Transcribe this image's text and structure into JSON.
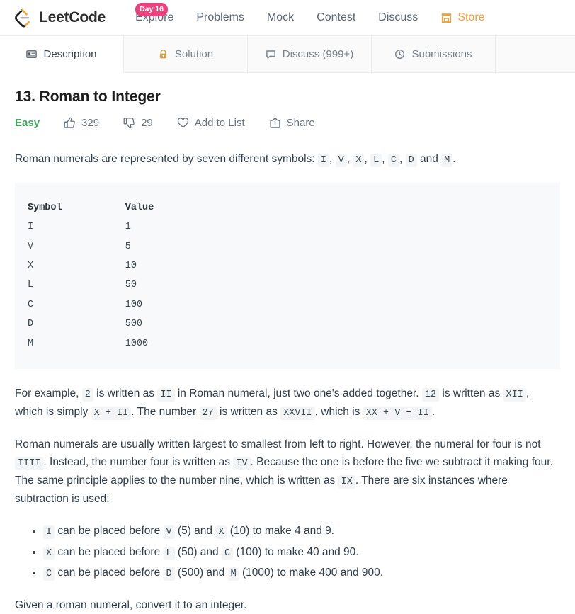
{
  "nav": {
    "brand_name": "LeetCode",
    "brand_logo_icon": "leetcode-logo-icon",
    "day_badge": "Day 16",
    "links": [
      {
        "label": "Explore",
        "icon": null
      },
      {
        "label": "Problems",
        "icon": null
      },
      {
        "label": "Mock",
        "icon": null
      },
      {
        "label": "Contest",
        "icon": null
      },
      {
        "label": "Discuss",
        "icon": null
      },
      {
        "label": "Store",
        "icon": "store-icon"
      }
    ]
  },
  "tabs": [
    {
      "label": "Description",
      "icon": "description-icon",
      "active": true
    },
    {
      "label": "Solution",
      "icon": "lock-icon",
      "active": false
    },
    {
      "label": "Discuss (999+)",
      "icon": "comment-icon",
      "active": false
    },
    {
      "label": "Submissions",
      "icon": "clock-icon",
      "active": false
    }
  ],
  "problem": {
    "title": "13. Roman to Integer",
    "difficulty": "Easy",
    "likes": "329",
    "dislikes": "29",
    "add_to_list_label": "Add to List",
    "share_label": "Share"
  },
  "description": {
    "intro_before": "Roman numerals are represented by seven different symbols: ",
    "intro_symbols": [
      "I",
      "V",
      "X",
      "L",
      "C",
      "D",
      "M"
    ],
    "intro_conjunction": " and ",
    "intro_end": ".",
    "table": {
      "headers": [
        "Symbol",
        "Value"
      ],
      "rows": [
        [
          "I",
          "1"
        ],
        [
          "V",
          "5"
        ],
        [
          "X",
          "10"
        ],
        [
          "L",
          "50"
        ],
        [
          "C",
          "100"
        ],
        [
          "D",
          "500"
        ],
        [
          "M",
          "1000"
        ]
      ]
    },
    "example_p1": {
      "s1": "For example, ",
      "c1": "2",
      "s2": " is written as ",
      "c2": "II",
      "s3": " in Roman numeral, just two one's added together. ",
      "c3": "12",
      "s4": " is written as ",
      "c4": "XII",
      "s5": ", which is simply ",
      "c5": "X + II",
      "s6": ". The number ",
      "c6": "27",
      "s7": " is written as ",
      "c7": "XXVII",
      "s8": ", which is ",
      "c8": "XX + V + II",
      "s9": "."
    },
    "rules_p2": {
      "s1": "Roman numerals are usually written largest to smallest from left to right. However, the numeral for four is not ",
      "c1": "IIII",
      "s2": ". Instead, the number four is written as ",
      "c2": "IV",
      "s3": ". Because the one is before the five we subtract it making four. The same principle applies to the number nine, which is written as ",
      "c3": "IX",
      "s4": ". There are six instances where subtraction is used:"
    },
    "bullets": [
      {
        "c1": "I",
        "s1": " can be placed before ",
        "c2": "V",
        "s2": " (5) and ",
        "c3": "X",
        "s3": " (10) to make 4 and 9."
      },
      {
        "c1": "X",
        "s1": " can be placed before ",
        "c2": "L",
        "s2": " (50) and ",
        "c3": "C",
        "s3": " (100) to make 40 and 90."
      },
      {
        "c1": "C",
        "s1": " can be placed before ",
        "c2": "D",
        "s2": " (500) and ",
        "c3": "M",
        "s3": " (1000) to make 400 and 900."
      }
    ],
    "closing": "Given a roman numeral, convert it to an integer."
  },
  "colors": {
    "brand_orange": "#f0a23c",
    "badge_pink": "#e8447f",
    "easy_green": "#41a85f",
    "lock_gold": "#c9a24a",
    "code_bg": "#f7f9fa"
  }
}
